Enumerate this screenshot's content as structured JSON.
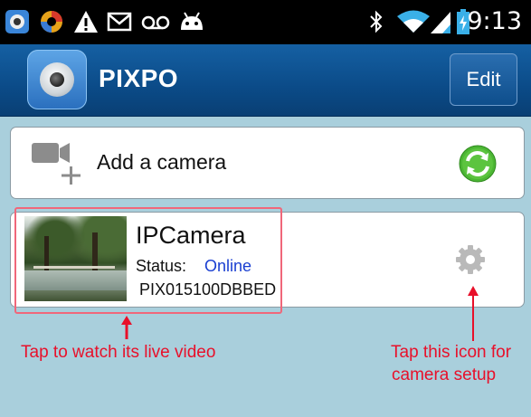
{
  "status_bar": {
    "time": "9:13",
    "left_icons": [
      "app-notification-icon",
      "sync-icon",
      "warning-icon",
      "gmail-icon",
      "voicemail-icon",
      "android-icon"
    ],
    "right_icons": [
      "bluetooth-icon",
      "wifi-icon",
      "signal-icon",
      "battery-charging-icon"
    ]
  },
  "app_bar": {
    "title": "PIXPO",
    "edit_label": "Edit"
  },
  "add_camera": {
    "label": "Add a camera",
    "icon": "add-camera-icon",
    "action_icon": "refresh-icon",
    "action_color": "#4cb634"
  },
  "camera": {
    "name": "IPCamera",
    "status_label": "Status:",
    "status_value": "Online",
    "status_color": "#1a3fd1",
    "id": "PIX015100DBBED",
    "settings_icon": "gear-icon"
  },
  "annotations": {
    "left": "Tap to watch its live video",
    "right_line1": "Tap this icon for",
    "right_line2": "camera setup",
    "color": "#e8102a"
  }
}
